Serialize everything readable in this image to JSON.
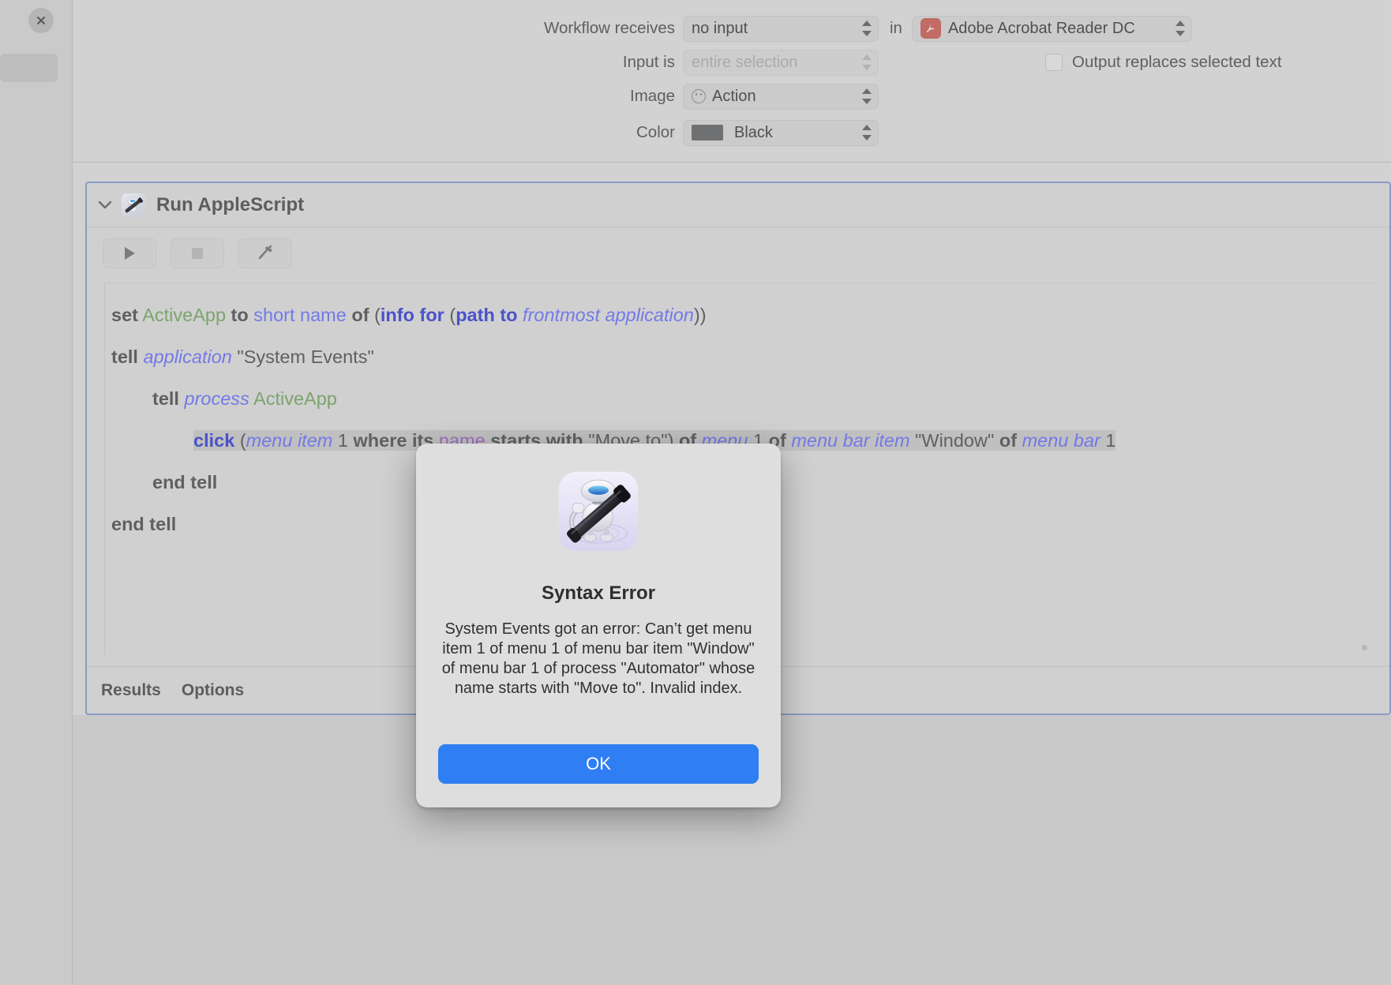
{
  "window": {
    "close_label": "close-window",
    "app": "Automator"
  },
  "config": {
    "workflow_receives_label": "Workflow receives",
    "workflow_receives_value": "no input",
    "in_label": "in",
    "target_app": "Adobe Acrobat Reader DC",
    "input_is_label": "Input is",
    "input_is_value": "entire selection",
    "output_replaces_label": "Output replaces selected text",
    "output_replaces_checked": false,
    "image_label": "Image",
    "image_value": "Action",
    "color_label": "Color",
    "color_value": "Black",
    "color_swatch_hex": "#6e7072"
  },
  "action": {
    "title": "Run AppleScript",
    "icon": "applescript-icon",
    "toolbar": {
      "run_label": "run",
      "stop_label": "stop",
      "compile_label": "compile"
    },
    "code": {
      "line1": {
        "t1": "set",
        "t2": "ActiveApp",
        "t3": "to",
        "t4": "short name",
        "t5": "of",
        "t6": "(",
        "t7": "info for",
        "t8": "(",
        "t9": "path to",
        "t10": "frontmost application",
        "t11": "))"
      },
      "line2": {
        "t1": "tell",
        "t2": "application",
        "t3": "\"System Events\""
      },
      "line3": {
        "t1": "tell",
        "t2": "process",
        "t3": "ActiveApp"
      },
      "line4": {
        "t1": "click",
        "t2": "(",
        "t3": "menu item",
        "t4": "1",
        "t5": "where its",
        "t6": "name",
        "t7": "starts with",
        "t8": "\"Move to\")",
        "t9": "of",
        "t10": "menu",
        "t11": "1",
        "t12": "of",
        "t13": "menu bar item",
        "t14": "\"Window\"",
        "t15": "of",
        "t16": "menu bar",
        "t17": "1"
      },
      "line5": {
        "t1": "end tell"
      },
      "line6": {
        "t1": "end tell"
      }
    },
    "footer": {
      "results_tab": "Results",
      "options_tab": "Options"
    }
  },
  "dialog": {
    "icon": "automator-robot-icon",
    "title": "Syntax Error",
    "message": "System Events got an error: Can’t get menu item 1 of menu 1 of menu bar item \"Window\" of menu bar 1 of process \"Automator\" whose name starts with \"Move to\". Invalid index.",
    "ok_label": "OK"
  },
  "colors": {
    "accent_button": "#2f7ef3",
    "selection_highlight": "#c0c0c0",
    "card_border": "#8a9cc4",
    "keyword_blue": "#4b52c9",
    "class_italic": "#7279e8",
    "variable_green": "#7ca36d",
    "property_purple": "#9f6fbf",
    "acrobat_icon": "#c06b63"
  }
}
